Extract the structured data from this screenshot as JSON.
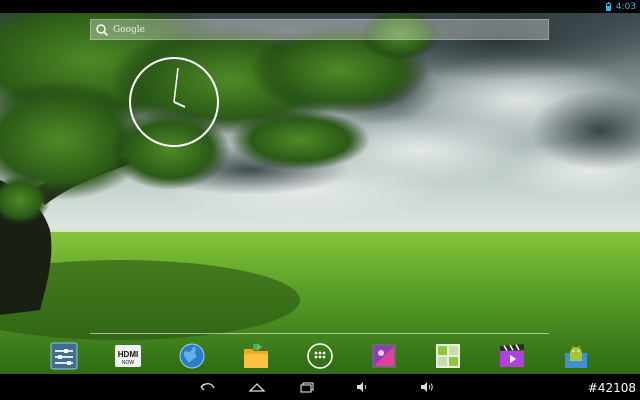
{
  "status_bar": {
    "time": "4:03",
    "icons": [
      "battery-icon"
    ]
  },
  "search": {
    "label": "Google",
    "icon": "search-icon"
  },
  "clock": {
    "type": "analog",
    "time": "4:03"
  },
  "dock": {
    "items": [
      {
        "name": "settings-icon"
      },
      {
        "name": "hdmi-now-icon",
        "line1": "HDMI",
        "line2": "NOW"
      },
      {
        "name": "browser-globe-icon"
      },
      {
        "name": "file-manager-icon"
      },
      {
        "name": "all-apps-icon"
      },
      {
        "name": "gallery-icon"
      },
      {
        "name": "app-store-icon"
      },
      {
        "name": "video-player-icon"
      },
      {
        "name": "apk-installer-icon"
      }
    ]
  },
  "nav_bar": {
    "buttons": [
      "back-icon",
      "home-icon",
      "recent-apps-icon",
      "volume-down-icon",
      "volume-up-icon"
    ]
  },
  "watermark": "#42108",
  "colors": {
    "status_accent": "#33b5e5",
    "nav_bg": "#000000"
  }
}
